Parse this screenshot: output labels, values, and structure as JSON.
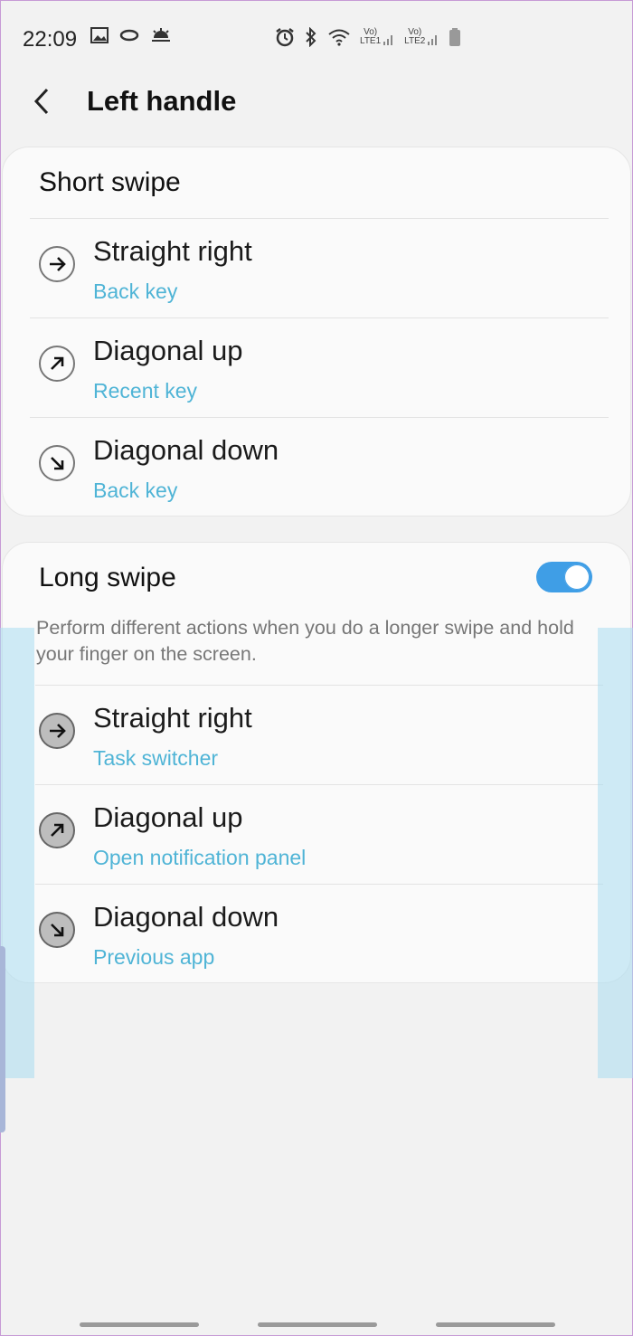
{
  "status": {
    "time": "22:09",
    "sim1": "LTE1",
    "sim2": "LTE2",
    "volte1": "Vo)",
    "volte2": "Vo)"
  },
  "header": {
    "title": "Left handle"
  },
  "short_swipe": {
    "title": "Short swipe",
    "items": [
      {
        "label": "Straight right",
        "value": "Back key",
        "icon": "arrow-right-icon"
      },
      {
        "label": "Diagonal up",
        "value": "Recent key",
        "icon": "arrow-up-right-icon"
      },
      {
        "label": "Diagonal down",
        "value": "Back key",
        "icon": "arrow-down-right-icon"
      }
    ]
  },
  "long_swipe": {
    "title": "Long swipe",
    "enabled": true,
    "description": "Perform different actions when you do a longer swipe and hold your finger on the screen.",
    "items": [
      {
        "label": "Straight right",
        "value": "Task switcher",
        "icon": "arrow-right-icon"
      },
      {
        "label": "Diagonal up",
        "value": "Open notification panel",
        "icon": "arrow-up-right-icon"
      },
      {
        "label": "Diagonal down",
        "value": "Previous app",
        "icon": "arrow-down-right-icon"
      }
    ]
  },
  "colors": {
    "accent": "#3f9ee6",
    "subtext": "#4fb4d6"
  }
}
